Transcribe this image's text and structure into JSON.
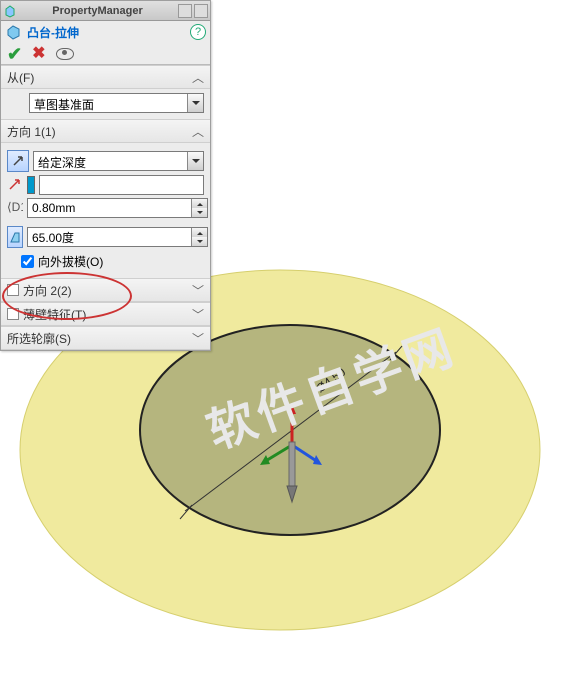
{
  "header": {
    "title": "PropertyManager"
  },
  "feature": {
    "name": "凸台-拉伸"
  },
  "sections": {
    "from": {
      "label": "从(F)",
      "dropdown": "草图基准面"
    },
    "dir1": {
      "label": "方向 1(1)",
      "end_condition": "给定深度",
      "depth": "0.80mm",
      "draft": "65.00度",
      "draft_outward_label": "向外拔模(O)",
      "draft_outward_checked": true
    },
    "dir2": {
      "label": "方向 2(2)",
      "checked": false
    },
    "thin": {
      "label": "薄壁特征(T)",
      "checked": false
    },
    "contours": {
      "label": "所选轮廓(S)"
    }
  },
  "viewport": {
    "dimension_label": "Ø4.50"
  }
}
